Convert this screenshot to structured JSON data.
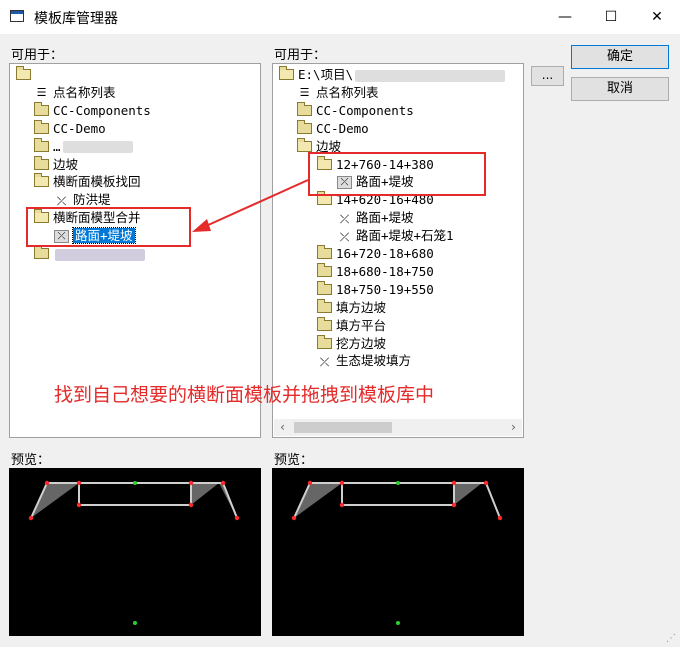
{
  "window": {
    "title": "模板库管理器",
    "minimize": "—",
    "maximize": "☐",
    "close": "✕"
  },
  "left_panel": {
    "label": "可用于：",
    "items": [
      {
        "text": "",
        "icon": "folder-open-icon"
      },
      {
        "text": "点名称列表",
        "icon": "list-icon"
      },
      {
        "text": "CC-Components",
        "icon": "folder-icon"
      },
      {
        "text": "CC-Demo",
        "icon": "folder-icon"
      },
      {
        "text": "…",
        "icon": "folder-icon"
      },
      {
        "text": "边坡",
        "icon": "folder-icon"
      },
      {
        "text": "横断面模板找回",
        "icon": "folder-open-icon"
      },
      {
        "text": "防洪堤",
        "icon": "template-icon"
      },
      {
        "text": "横断面模型合并",
        "icon": "folder-open-icon"
      },
      {
        "text": "路面+堤坡",
        "icon": "template-box-icon"
      },
      {
        "text": "",
        "icon": "folder-icon"
      }
    ]
  },
  "right_panel": {
    "label": "可用于：",
    "items": [
      {
        "text": "E:\\项目\\",
        "icon": "folder-open-icon"
      },
      {
        "text": "点名称列表",
        "icon": "list-icon"
      },
      {
        "text": "CC-Components",
        "icon": "folder-icon"
      },
      {
        "text": "CC-Demo",
        "icon": "folder-icon"
      },
      {
        "text": "边坡",
        "icon": "folder-open-icon"
      },
      {
        "text": "12+760-14+380",
        "icon": "folder-open-icon"
      },
      {
        "text": "路面+堤坡",
        "icon": "template-box-icon"
      },
      {
        "text": "14+620-16+480",
        "icon": "folder-open-icon"
      },
      {
        "text": "路面+堤坡",
        "icon": "template-icon"
      },
      {
        "text": "路面+堤坡+石笼1",
        "icon": "template-icon"
      },
      {
        "text": "16+720-18+680",
        "icon": "folder-icon"
      },
      {
        "text": "18+680-18+750",
        "icon": "folder-icon"
      },
      {
        "text": "18+750-19+550",
        "icon": "folder-icon"
      },
      {
        "text": "填方边坡",
        "icon": "folder-icon"
      },
      {
        "text": "填方平台",
        "icon": "folder-icon"
      },
      {
        "text": "挖方边坡",
        "icon": "folder-icon"
      },
      {
        "text": "生态堤坡填方",
        "icon": "template-icon"
      }
    ]
  },
  "buttons": {
    "ok": "确定",
    "cancel": "取消",
    "browse": "..."
  },
  "preview": {
    "left_label": "预览：",
    "right_label": "预览："
  },
  "annotation": "找到自己想要的横断面模板并拖拽到模板库中",
  "colors": {
    "highlight": "#e52a2a",
    "selection": "#0078d7",
    "preview_bg": "#000000"
  }
}
